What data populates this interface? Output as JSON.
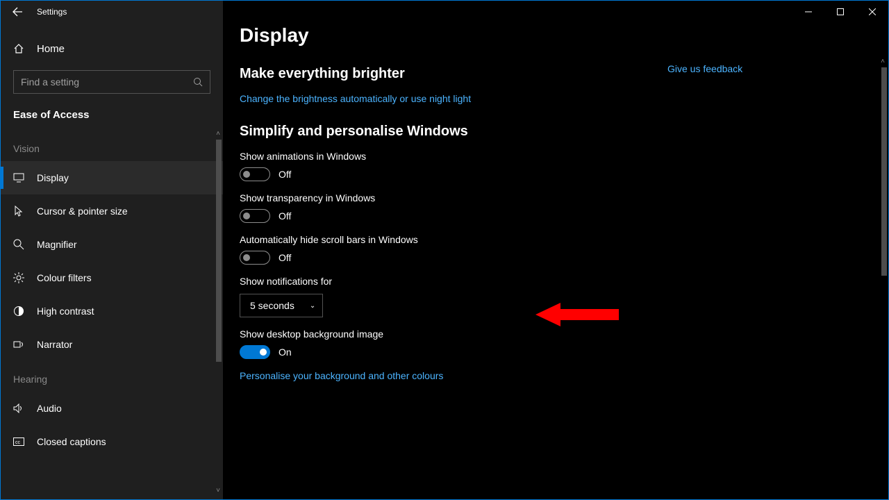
{
  "titlebar": {
    "title": "Settings"
  },
  "sidebar": {
    "home_label": "Home",
    "search_placeholder": "Find a setting",
    "category_label": "Ease of Access",
    "groups": [
      {
        "header": "Vision",
        "items": [
          {
            "label": "Display",
            "selected": true
          },
          {
            "label": "Cursor & pointer size"
          },
          {
            "label": "Magnifier"
          },
          {
            "label": "Colour filters"
          },
          {
            "label": "High contrast"
          },
          {
            "label": "Narrator"
          }
        ]
      },
      {
        "header": "Hearing",
        "items": [
          {
            "label": "Audio"
          },
          {
            "label": "Closed captions"
          }
        ]
      }
    ]
  },
  "main": {
    "page_title": "Display",
    "feedback_label": "Give us feedback",
    "section_brightness": {
      "title": "Make everything brighter",
      "link": "Change the brightness automatically or use night light"
    },
    "section_simplify": {
      "title": "Simplify and personalise Windows",
      "animations": {
        "label": "Show animations in Windows",
        "state": "Off",
        "on": false
      },
      "transparency": {
        "label": "Show transparency in Windows",
        "state": "Off",
        "on": false
      },
      "scrollbars": {
        "label": "Automatically hide scroll bars in Windows",
        "state": "Off",
        "on": false
      },
      "notifications": {
        "label": "Show notifications for",
        "value": "5 seconds"
      },
      "desktop_bg": {
        "label": "Show desktop background image",
        "state": "On",
        "on": true
      },
      "personalise_link": "Personalise your background and other colours"
    }
  }
}
